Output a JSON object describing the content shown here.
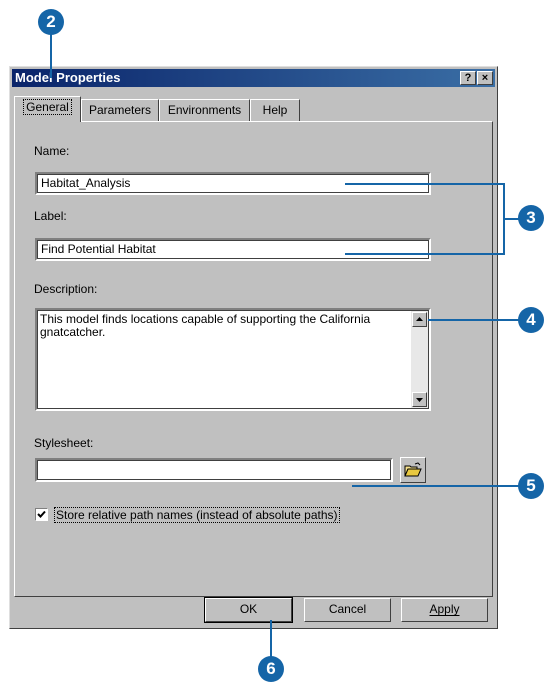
{
  "callouts": [
    "2",
    "3",
    "4",
    "5",
    "6"
  ],
  "window": {
    "title": "Model Properties",
    "help_button": "?",
    "close_button": "×"
  },
  "tabs": [
    {
      "label": "General",
      "active": true
    },
    {
      "label": "Parameters",
      "active": false
    },
    {
      "label": "Environments",
      "active": false
    },
    {
      "label": "Help",
      "active": false
    }
  ],
  "general": {
    "name_label": "Name:",
    "name_value": "Habitat_Analysis",
    "label_label": "Label:",
    "label_value": "Find Potential Habitat",
    "description_label": "Description:",
    "description_value": "This model finds locations capable of supporting the California gnatcatcher.",
    "stylesheet_label": "Stylesheet:",
    "stylesheet_value": "",
    "relative_paths_label": "Store relative path names (instead of absolute paths)",
    "relative_paths_checked": true
  },
  "buttons": {
    "ok": "OK",
    "cancel": "Cancel",
    "apply": "Apply"
  },
  "icons": {
    "browse": "open-folder-icon",
    "scroll_up": "arrow-up-icon",
    "scroll_down": "arrow-down-icon",
    "check": "checkmark-icon"
  },
  "colors": {
    "callout": "#1565a7",
    "titlebar_start": "#0a246a",
    "titlebar_end": "#3a6ea5",
    "face": "#c0c0c0"
  }
}
